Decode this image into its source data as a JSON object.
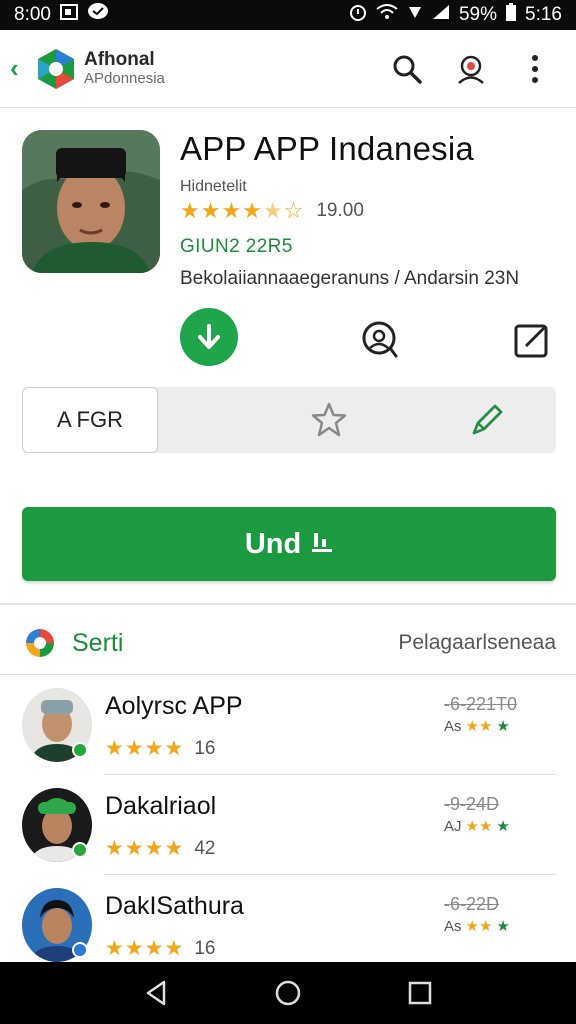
{
  "status_bar": {
    "time": "8:00",
    "battery": "59%",
    "clock_right": "5:16"
  },
  "app_bar": {
    "brand_title": "Afhonal",
    "brand_subtitle": "APdonnesia",
    "actions": [
      "search-icon",
      "account-icon",
      "more-vertical-icon"
    ]
  },
  "app": {
    "title": "APP APP Indanesia",
    "publisher": "Hidnetelit",
    "rating_stars": 4.5,
    "rating_count": "19.00",
    "code": "GIUN2 22R5",
    "description": "Bekolaiiannaaegeranuns / Andarsin 23N"
  },
  "segmented": {
    "selected_label": "A FGR",
    "icons": [
      "star-outline-icon",
      "pencil-icon"
    ]
  },
  "install_button": {
    "label": "Und",
    "icon": "download-bars-icon"
  },
  "section": {
    "title": "Serti",
    "right_text": "Pelagaarlseneaa"
  },
  "list": [
    {
      "name": "Aolyrsc APP",
      "stars": 4,
      "count": "16",
      "meta": "-6-221T0",
      "mini_prefix": "As",
      "badge_color": "#26a83f"
    },
    {
      "name": "Dakalriaol",
      "stars": 4,
      "count": "42",
      "meta": "-9-24D",
      "mini_prefix": "AJ",
      "badge_color": "#26a83f"
    },
    {
      "name": "DakISathura",
      "stars": 4,
      "count": "16",
      "meta": "-6-22D",
      "mini_prefix": "As",
      "badge_color": "#2d7ad6"
    }
  ],
  "colors": {
    "accent_green": "#1c9a3f",
    "star": "#f2a71b",
    "status_bg": "#0b0b0b",
    "nav_bg": "#000000"
  }
}
